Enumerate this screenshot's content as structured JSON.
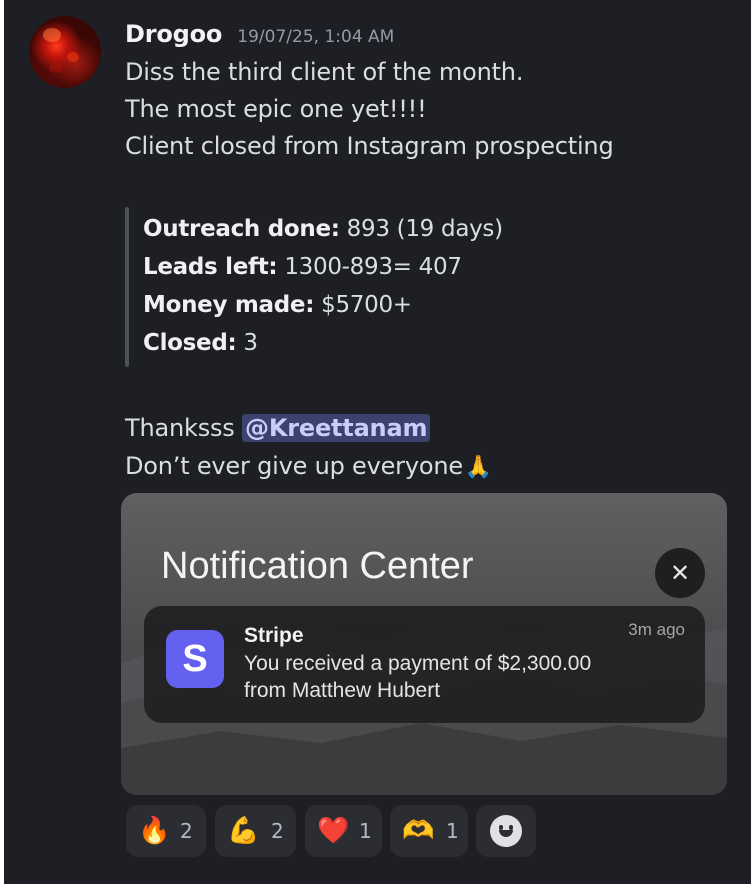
{
  "author": {
    "name": "Drogoo",
    "timestamp": "19/07/25, 1:04 AM"
  },
  "message": {
    "lines": [
      "Diss the third client of the month.",
      "The most epic one yet!!!!",
      "Client closed from Instagram prospecting"
    ],
    "quote": [
      {
        "label": "Outreach done:",
        "value": " 893 (19 days)"
      },
      {
        "label": "Leads left:",
        "value": " 1300-893= 407"
      },
      {
        "label": "Money made:",
        "value": " $5700+"
      },
      {
        "label": "Closed:",
        "value": " 3"
      }
    ],
    "thanks_prefix": "Thanksss ",
    "mention": "@Kreettanam",
    "closing_line": "Don’t ever give up everyone",
    "closing_emoji": "🙏"
  },
  "embed": {
    "title": "Notification Center",
    "close_glyph": "✕",
    "notification": {
      "logo_letter": "S",
      "app": "Stripe",
      "time": "3m ago",
      "body_line1": "You received a payment of $2,300.00",
      "body_line2": "from Matthew Hubert"
    }
  },
  "reactions": [
    {
      "emoji": "🔥",
      "count": "2"
    },
    {
      "emoji": "💪",
      "count": "2"
    },
    {
      "emoji": "❤️",
      "count": "1"
    },
    {
      "emoji": "🫶",
      "count": "1"
    }
  ],
  "colors": {
    "background": "#1e1f24",
    "mention_bg": "#3c4270",
    "stripe_brand": "#6461f0",
    "reaction_bg": "#2b2d33"
  }
}
